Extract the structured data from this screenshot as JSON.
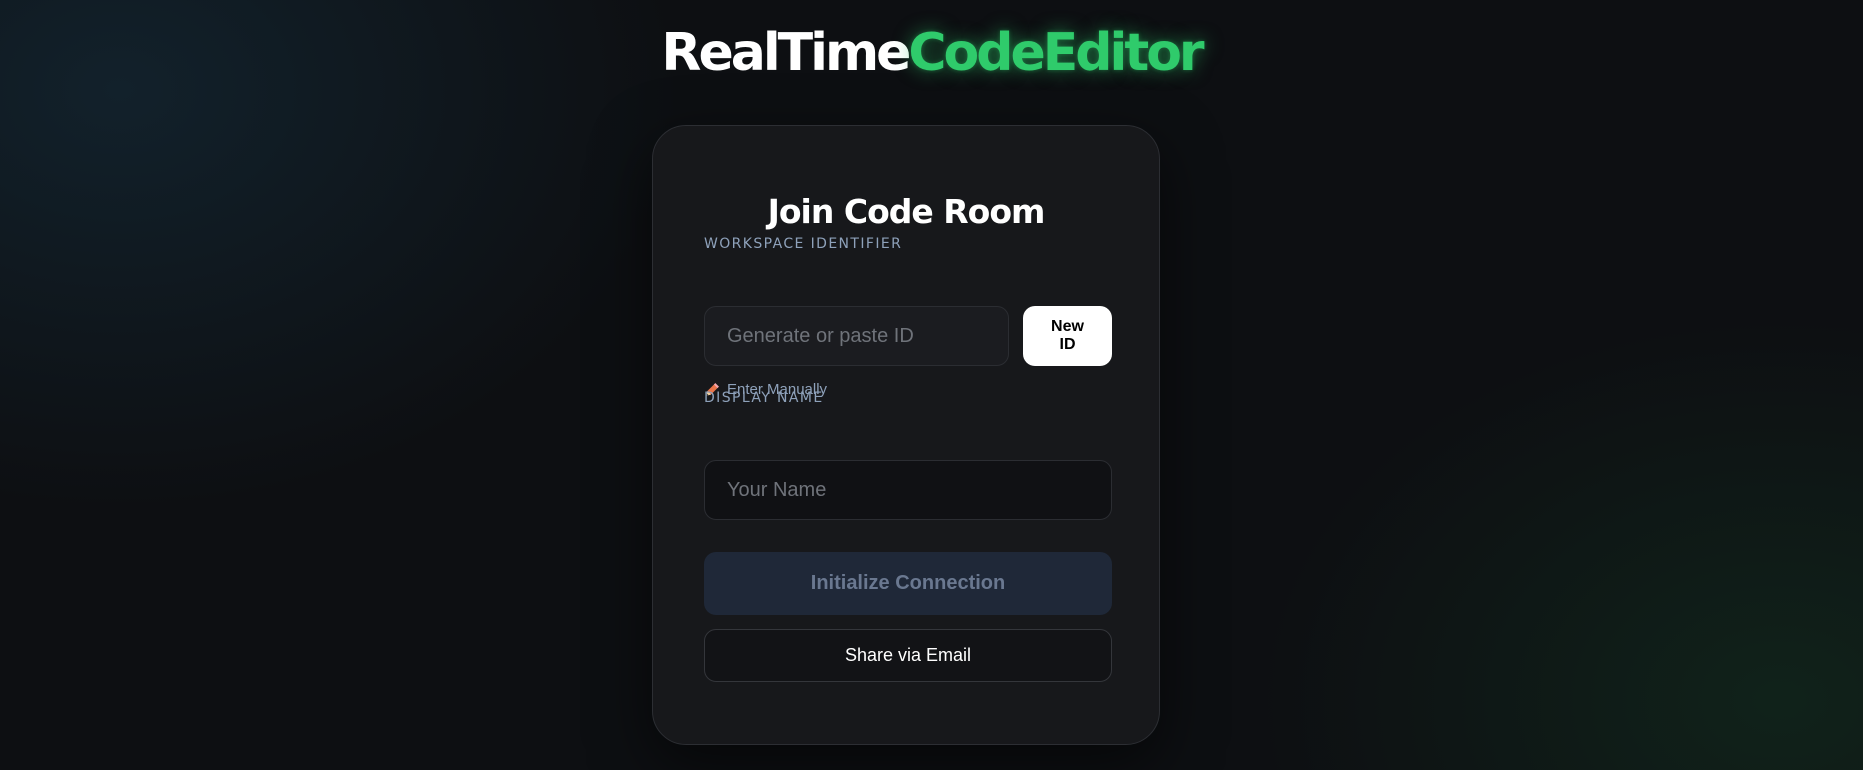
{
  "header": {
    "logo_part_a": "RealTime",
    "logo_part_b": "CodeEditor"
  },
  "card": {
    "title": "Join Code Room",
    "room_id_label": "WORKSPACE IDENTIFIER",
    "room_id_placeholder": "Generate or paste ID",
    "room_id_value": "",
    "new_id_label": "New ID",
    "manual_entry_icon": "pencil-icon",
    "manual_entry_label": "Enter Manually",
    "display_name_label": "DISPLAY NAME",
    "display_name_placeholder": "Your Name",
    "display_name_value": "",
    "initialize_label": "Initialize Connection",
    "share_label": "Share via Email"
  },
  "colors": {
    "accent": "#2fcb6b",
    "background": "#0d0f12",
    "card": "#17181b",
    "label": "#8ea1ba",
    "disabled_button": "#1f2838",
    "disabled_text": "#6a7890"
  }
}
